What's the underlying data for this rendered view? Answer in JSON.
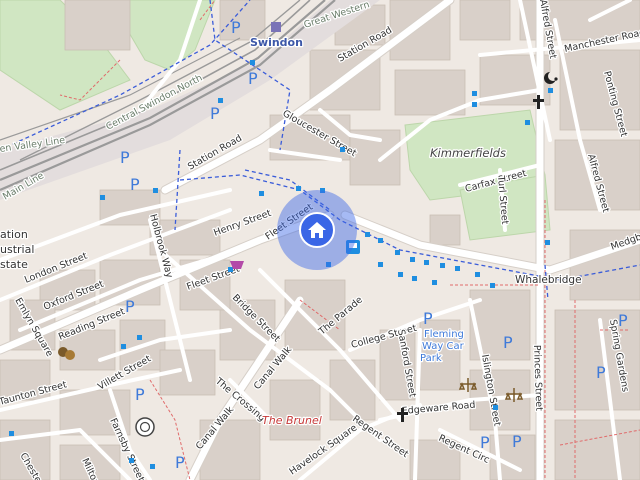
{
  "map": {
    "station": "Swindon",
    "places": {
      "kimmerfields": "Kimmerfields",
      "whalebridge": "Whalebridge",
      "the_brunel": "The Brunel",
      "car_park": [
        "Fleming",
        "Way Car",
        "Park"
      ],
      "estate": [
        "ation",
        "ustrial",
        "state"
      ]
    },
    "streets": {
      "station_road_1": "Station Road",
      "station_road_2": "Station Road",
      "gloucester": "Gloucester Street",
      "henry": "Henry Street",
      "fleet_1": "Fleet Street",
      "fleet_2": "Fleet Street",
      "bridge": "Bridge Street",
      "the_parade": "The Parade",
      "london": "London Street",
      "oxford": "Oxford Street",
      "reading": "Reading Street",
      "emlyn": "Emlyn Square",
      "holbrook": "Holbrook Way",
      "college": "College Street",
      "sanford": "Sanford Street",
      "islington": "Islington Street",
      "princes": "Princes Street",
      "edgeware": "Edgeware Road",
      "regent_1": "Regent Street",
      "regent_2": "Regent Circ",
      "havelock": "Havelock Square",
      "canal_walk_1": "Canal Walk",
      "canal_walk_2": "Canal Walk",
      "the_crossing": "The Crossing",
      "villett": "Villett Street",
      "farnsby": "Farnsby Street",
      "milton": "Milton",
      "chester": "Chester",
      "taunton": "Taunton Street",
      "carfax": "Carfax Street",
      "turl": "Turl Street",
      "alfred_1": "Alfred Street",
      "alfred_2": "Alfred Street",
      "manchester": "Manchester Road",
      "ponting": "Ponting Street",
      "spring": "Spring Gardens",
      "medgbury": "Medgb",
      "great_western": "Great Western",
      "central_swindon_north": "Central Swindon North",
      "golden_valley": "en Valley Line",
      "main_line": "Main Line",
      "state": "state"
    },
    "parking_label": "P",
    "colors": {
      "background": "#efe9e3",
      "building": "#d9d0c9",
      "road": "#ffffff",
      "green": "#d0e6c2",
      "rail": "#9a9a9a",
      "location": "#3a66e6",
      "bus_stop": "#1f8ee0",
      "parking": "#3f7ad9"
    },
    "icons": [
      "home-icon",
      "parking-icon",
      "bus-stop-icon",
      "church-icon",
      "mosque-icon",
      "theatre-icon",
      "court-icon",
      "roundabout-icon",
      "railway-station-icon"
    ]
  }
}
